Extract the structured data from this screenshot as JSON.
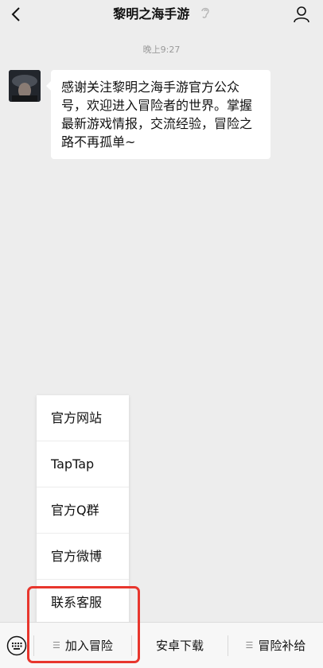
{
  "header": {
    "title": "黎明之海手游",
    "back_icon": "chevron-left-icon",
    "ear_icon": "ear-icon",
    "profile_icon": "person-icon"
  },
  "chat": {
    "time": "晚上9:27",
    "message": "感谢关注黎明之海手游官方公众号，欢迎进入冒险者的世界。掌握最新游戏情报，交流经验，冒险之路不再孤单~"
  },
  "popup": {
    "items": [
      {
        "label": "官方网站"
      },
      {
        "label": "TapTap"
      },
      {
        "label": "官方Q群"
      },
      {
        "label": "官方微博"
      },
      {
        "label": "联系客服"
      }
    ]
  },
  "bottombar": {
    "keyboard_icon": "keyboard-icon",
    "menus": [
      {
        "label": "加入冒险",
        "has_submenu": true
      },
      {
        "label": "安卓下载",
        "has_submenu": false
      },
      {
        "label": "冒险补给",
        "has_submenu": true
      }
    ]
  },
  "colors": {
    "highlight": "#e8362d",
    "background": "#ededed"
  }
}
